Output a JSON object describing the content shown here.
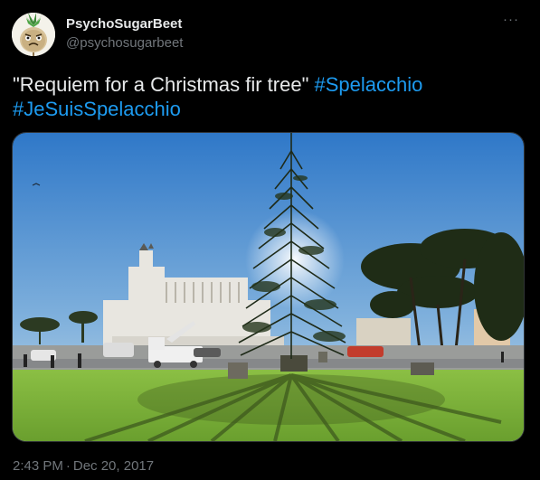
{
  "tweet": {
    "author": {
      "display_name": "PsychoSugarBeet",
      "handle": "@psychosugarbeet",
      "avatar_icon": "sugar-beet-avatar-icon"
    },
    "more_label": "···",
    "text": "\"Requiem for a Christmas fir tree\"",
    "hashtags": [
      "#Spelacchio",
      "#JeSuisSpelacchio"
    ],
    "media": {
      "icon": "photo-christmas-tree-rome"
    },
    "time": "2:43 PM",
    "separator": "·",
    "date": "Dec 20, 2017"
  },
  "colors": {
    "background": "#000000",
    "text_primary": "#e7e9ea",
    "text_secondary": "#71767b",
    "hashtag": "#1d9bf0",
    "border": "#2f3336"
  }
}
